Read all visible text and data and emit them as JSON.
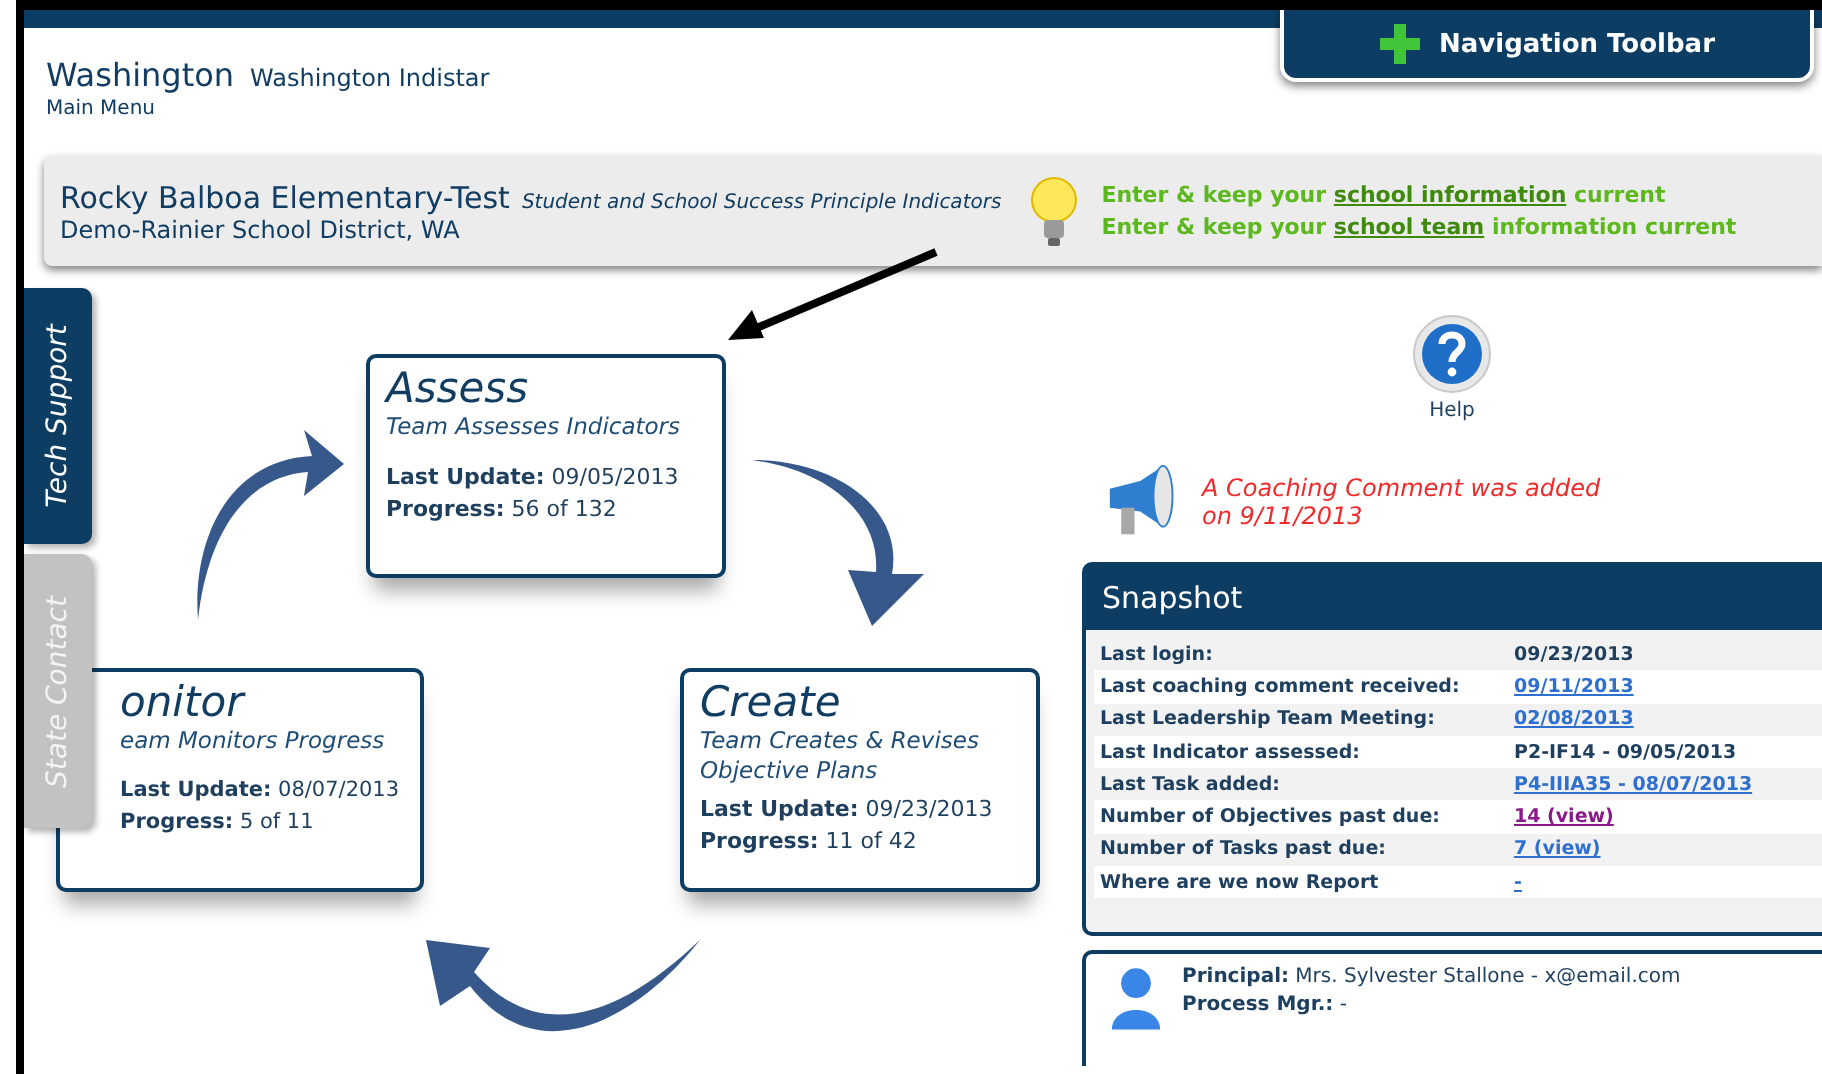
{
  "header": {
    "title": "Washington",
    "subtitle": "Washington Indistar",
    "menu_link": "Main Menu"
  },
  "nav_toolbar": {
    "label": "Navigation Toolbar"
  },
  "school": {
    "name": "Rocky Balboa Elementary-Test",
    "tagline": "Student and School Success Principle Indicators",
    "district": "Demo-Rainier School District, WA",
    "tips": [
      [
        {
          "text": "Enter & keep your ",
          "link": false
        },
        {
          "text": "school information",
          "link": true
        },
        {
          "text": " current",
          "link": false
        }
      ],
      [
        {
          "text": "Enter & keep your ",
          "link": false
        },
        {
          "text": "school team",
          "link": true
        },
        {
          "text": " information current",
          "link": false
        }
      ]
    ]
  },
  "side_tabs": [
    {
      "label": "Tech Support",
      "selected": true
    },
    {
      "label": "State Contact",
      "selected": false
    }
  ],
  "cycle": [
    {
      "title": "Assess",
      "subtitle": "Team Assesses Indicators",
      "update": "**Last Update:** 09/05/2013",
      "progress": "**Progress:** 56 of 132"
    },
    {
      "title": "onitor",
      "subtitle": "eam Monitors Progress",
      "update": "**Last Update:** 08/07/2013",
      "progress": "**Progress:** 5 of 11"
    },
    {
      "title": "Create",
      "subtitle": "Team Creates & Revises Objective Plans",
      "update": "**Last Update:** 09/23/2013",
      "progress": "**Progress:** 11 of 42"
    }
  ],
  "help": {
    "label": "Help"
  },
  "coaching_notice": "A Coaching Comment was added on 9/11/2013",
  "snapshot": {
    "title": "Snapshot",
    "rows": [
      {
        "label": "Last login:",
        "value": "09/23/2013",
        "kind": "text"
      },
      {
        "label": "Last coaching comment received:",
        "value": "09/11/2013",
        "kind": "link"
      },
      {
        "label": "Last Leadership Team Meeting:",
        "value": "02/08/2013",
        "kind": "link"
      },
      {
        "label": "Last Indicator assessed:",
        "value": "P2-IF14 - 09/05/2013",
        "kind": "text"
      },
      {
        "label": "Last Task added:",
        "value": "P4-IIIA35 - 08/07/2013",
        "kind": "link"
      },
      {
        "label": "Number of Objectives past due:",
        "value": "14 (view)",
        "kind": "visited"
      },
      {
        "label": "Number of Tasks past due:",
        "value": "7 (view)",
        "kind": "link"
      },
      {
        "label": "Where are we now Report",
        "value": "-",
        "kind": "link"
      }
    ]
  },
  "contacts": [
    "**Principal:** Mrs. Sylvester Stallone - x@email.com",
    "**Process Mgr.:** -"
  ]
}
